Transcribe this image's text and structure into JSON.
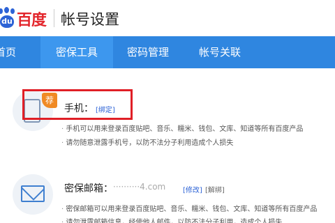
{
  "header": {
    "logo_text": "百度",
    "logo_mark": "du",
    "title": "帐号设置"
  },
  "nav": {
    "items": [
      {
        "label": "首页"
      },
      {
        "label": "密保工具",
        "active": true
      },
      {
        "label": "密码管理"
      },
      {
        "label": "帐号关联"
      }
    ]
  },
  "phone_row": {
    "badge": "荐",
    "label": "手机：",
    "bind_link": "[绑定]",
    "bullets": [
      "手机可以用来登录百度贴吧、音乐、糯米、钱包、文库、知道等所有百度产品",
      "请勿随意泄露手机号，以防不法分子利用造成个人损失"
    ]
  },
  "email_row": {
    "label": "密保邮箱：",
    "email_masked": "··········4.com",
    "edit_link": "[修改]",
    "unbind_link": "[解绑]",
    "bullets": [
      "密保邮箱可以用来登录百度贴吧、音乐、糯米、钱包、文库、知道等所有百度产品",
      "请勿泄露邮箱信息，经使他人邮件，以防不法分子利用，造成个人损失"
    ]
  },
  "icons": {
    "phone": "mobile-phone-icon",
    "email": "envelope-icon"
  },
  "colors": {
    "nav_bg": "#2f86e0",
    "brand_blue": "#2d63d6",
    "brand_red": "#e3262c",
    "highlight_red": "#e01f26",
    "badge_orange": "#f08a24"
  }
}
